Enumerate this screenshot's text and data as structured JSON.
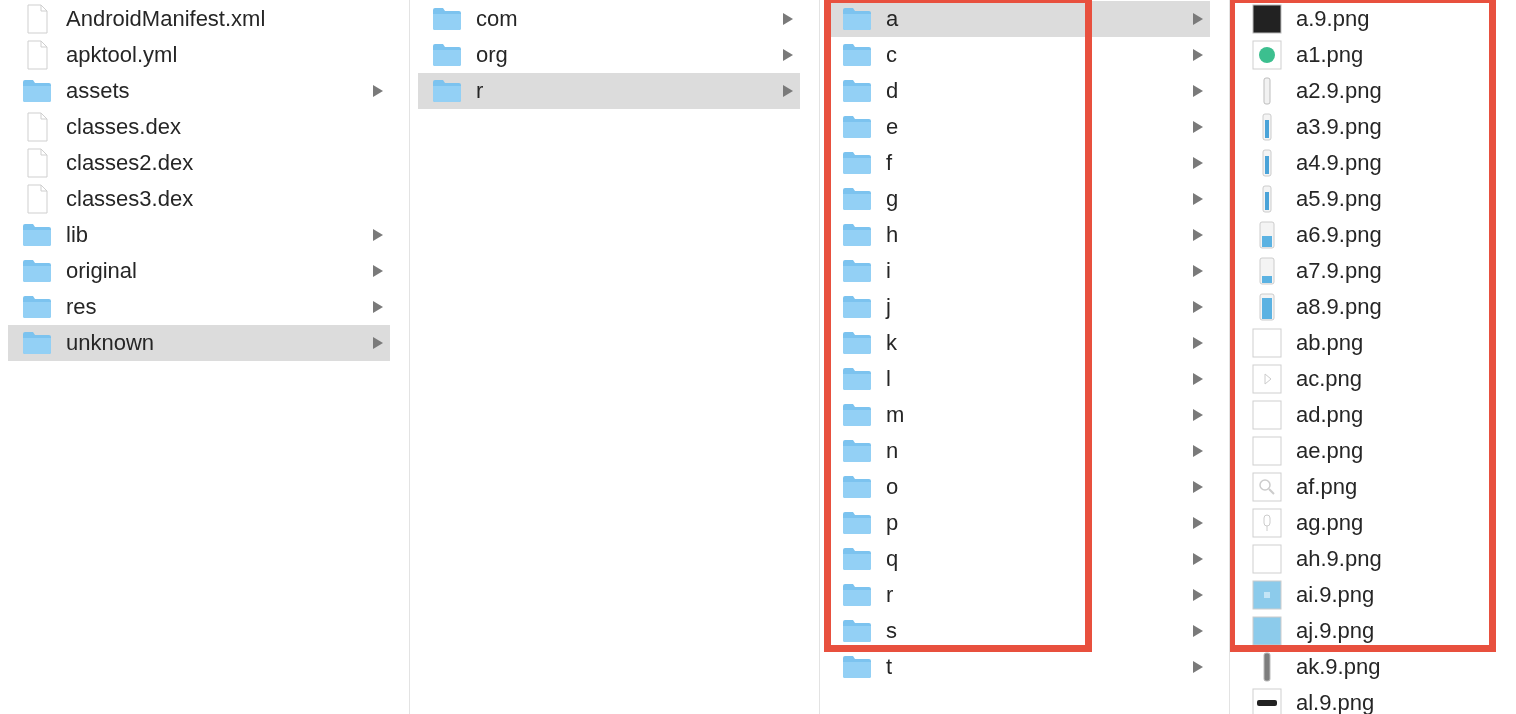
{
  "columns": [
    {
      "items": [
        {
          "name": "AndroidManifest.xml",
          "kind": "document",
          "has_children": false,
          "selected": false
        },
        {
          "name": "apktool.yml",
          "kind": "document",
          "has_children": false,
          "selected": false
        },
        {
          "name": "assets",
          "kind": "folder",
          "has_children": true,
          "selected": false
        },
        {
          "name": "classes.dex",
          "kind": "document",
          "has_children": false,
          "selected": false
        },
        {
          "name": "classes2.dex",
          "kind": "document",
          "has_children": false,
          "selected": false
        },
        {
          "name": "classes3.dex",
          "kind": "document",
          "has_children": false,
          "selected": false
        },
        {
          "name": "lib",
          "kind": "folder",
          "has_children": true,
          "selected": false
        },
        {
          "name": "original",
          "kind": "folder",
          "has_children": true,
          "selected": false
        },
        {
          "name": "res",
          "kind": "folder",
          "has_children": true,
          "selected": false
        },
        {
          "name": "unknown",
          "kind": "folder",
          "has_children": true,
          "selected": true
        }
      ]
    },
    {
      "items": [
        {
          "name": "com",
          "kind": "folder",
          "has_children": true,
          "selected": false
        },
        {
          "name": "org",
          "kind": "folder",
          "has_children": true,
          "selected": false
        },
        {
          "name": "r",
          "kind": "folder",
          "has_children": true,
          "selected": true
        }
      ]
    },
    {
      "framed_items": [
        {
          "name": "a",
          "kind": "folder",
          "has_children": true,
          "selected": true
        },
        {
          "name": "c",
          "kind": "folder",
          "has_children": true,
          "selected": false
        },
        {
          "name": "d",
          "kind": "folder",
          "has_children": true,
          "selected": false
        },
        {
          "name": "e",
          "kind": "folder",
          "has_children": true,
          "selected": false
        },
        {
          "name": "f",
          "kind": "folder",
          "has_children": true,
          "selected": false
        },
        {
          "name": "g",
          "kind": "folder",
          "has_children": true,
          "selected": false
        },
        {
          "name": "h",
          "kind": "folder",
          "has_children": true,
          "selected": false
        },
        {
          "name": "i",
          "kind": "folder",
          "has_children": true,
          "selected": false
        },
        {
          "name": "j",
          "kind": "folder",
          "has_children": true,
          "selected": false
        },
        {
          "name": "k",
          "kind": "folder",
          "has_children": true,
          "selected": false
        },
        {
          "name": "l",
          "kind": "folder",
          "has_children": true,
          "selected": false
        },
        {
          "name": "m",
          "kind": "folder",
          "has_children": true,
          "selected": false
        },
        {
          "name": "n",
          "kind": "folder",
          "has_children": true,
          "selected": false
        },
        {
          "name": "o",
          "kind": "folder",
          "has_children": true,
          "selected": false
        },
        {
          "name": "p",
          "kind": "folder",
          "has_children": true,
          "selected": false
        },
        {
          "name": "q",
          "kind": "folder",
          "has_children": true,
          "selected": false
        },
        {
          "name": "r",
          "kind": "folder",
          "has_children": true,
          "selected": false
        },
        {
          "name": "s",
          "kind": "folder",
          "has_children": true,
          "selected": false
        }
      ],
      "items": [
        {
          "name": "t",
          "kind": "folder",
          "has_children": true,
          "selected": false
        }
      ]
    },
    {
      "framed_items": [
        {
          "name": "a.9.png",
          "kind": "image",
          "has_children": false,
          "selected": false
        },
        {
          "name": "a1.png",
          "kind": "image",
          "has_children": false,
          "selected": false
        },
        {
          "name": "a2.9.png",
          "kind": "image",
          "has_children": false,
          "selected": false
        },
        {
          "name": "a3.9.png",
          "kind": "image",
          "has_children": false,
          "selected": false
        },
        {
          "name": "a4.9.png",
          "kind": "image",
          "has_children": false,
          "selected": false
        },
        {
          "name": "a5.9.png",
          "kind": "image",
          "has_children": false,
          "selected": false
        },
        {
          "name": "a6.9.png",
          "kind": "image",
          "has_children": false,
          "selected": false
        },
        {
          "name": "a7.9.png",
          "kind": "image",
          "has_children": false,
          "selected": false
        },
        {
          "name": "a8.9.png",
          "kind": "image",
          "has_children": false,
          "selected": false
        },
        {
          "name": "ab.png",
          "kind": "image",
          "has_children": false,
          "selected": false
        },
        {
          "name": "ac.png",
          "kind": "image",
          "has_children": false,
          "selected": false
        },
        {
          "name": "ad.png",
          "kind": "image",
          "has_children": false,
          "selected": false
        },
        {
          "name": "ae.png",
          "kind": "image",
          "has_children": false,
          "selected": false
        },
        {
          "name": "af.png",
          "kind": "image",
          "has_children": false,
          "selected": false
        },
        {
          "name": "ag.png",
          "kind": "image",
          "has_children": false,
          "selected": false
        },
        {
          "name": "ah.9.png",
          "kind": "image",
          "has_children": false,
          "selected": false
        },
        {
          "name": "ai.9.png",
          "kind": "image",
          "has_children": false,
          "selected": false
        },
        {
          "name": "aj.9.png",
          "kind": "image",
          "has_children": false,
          "selected": false
        }
      ],
      "items": [
        {
          "name": "ak.9.png",
          "kind": "image",
          "has_children": false,
          "selected": false
        },
        {
          "name": "al.9.png",
          "kind": "image",
          "has_children": false,
          "selected": false
        }
      ]
    }
  ]
}
